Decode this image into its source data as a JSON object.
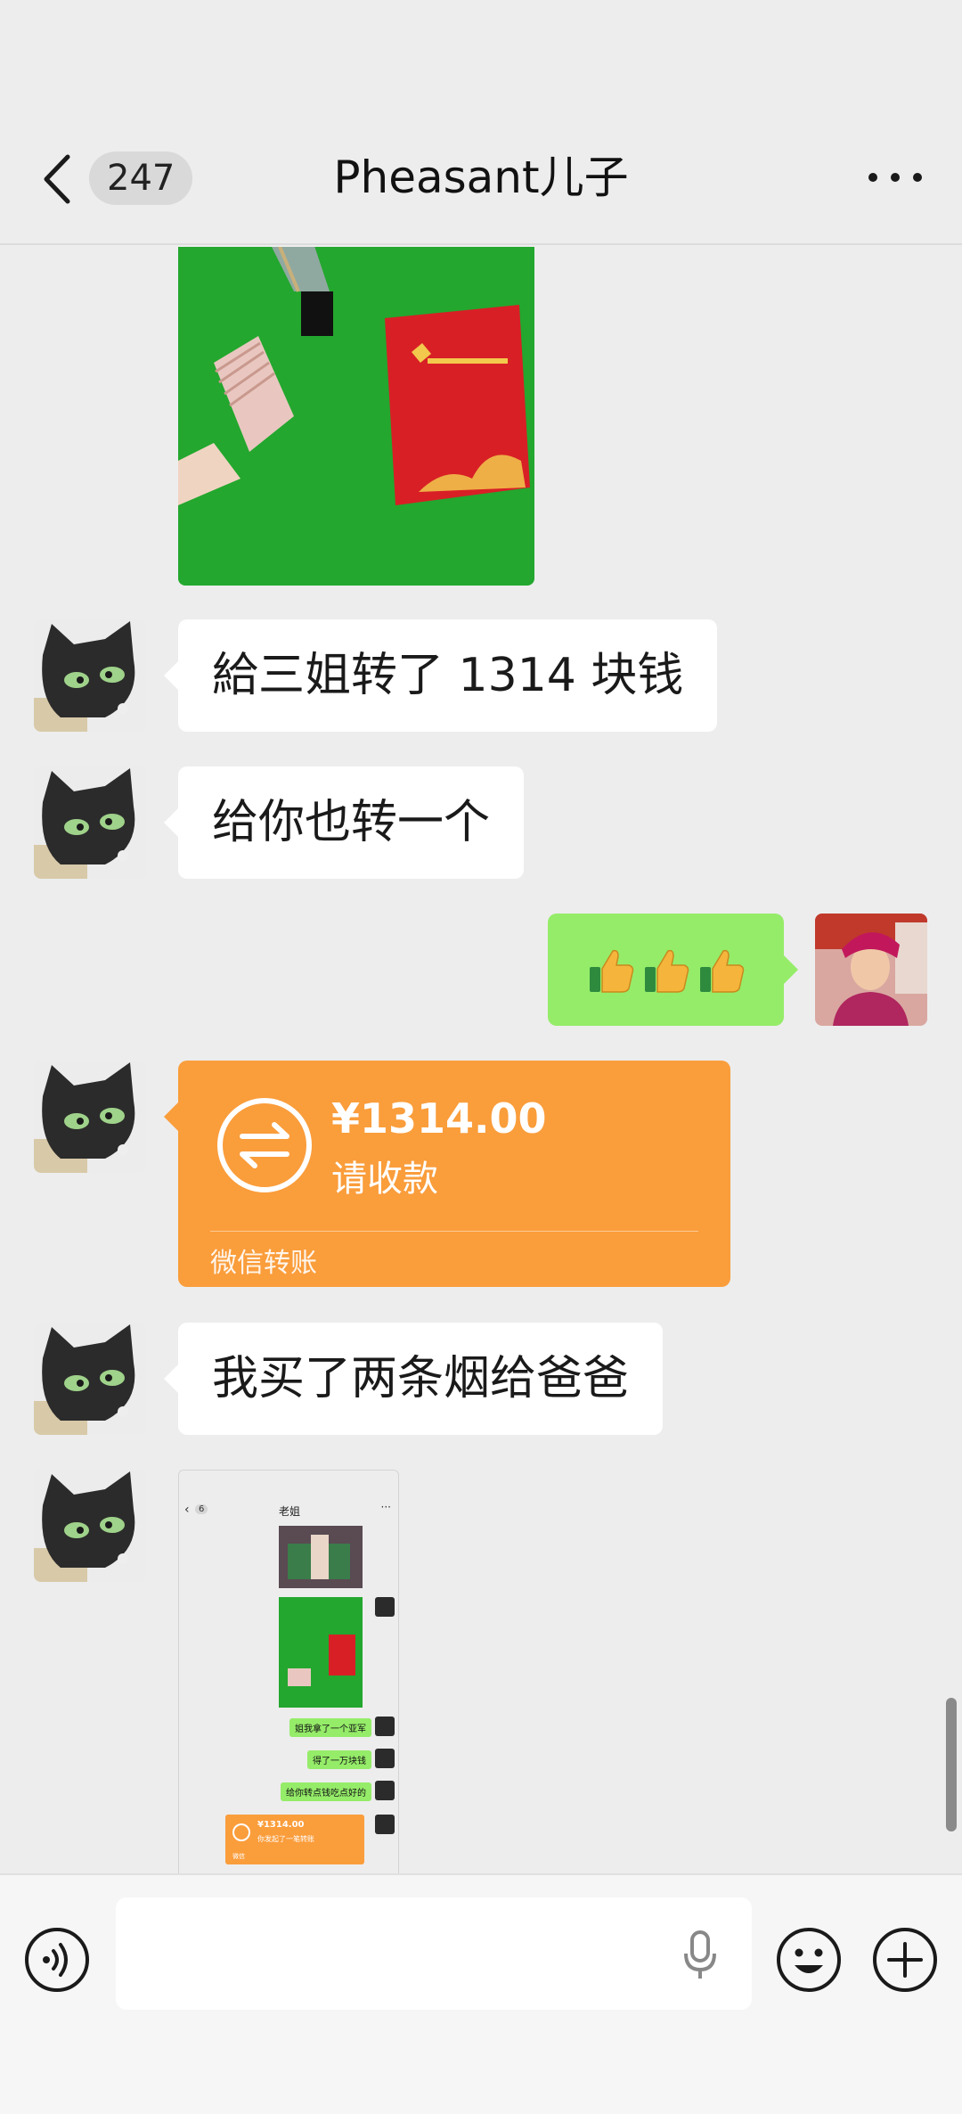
{
  "header": {
    "unread_count": "247",
    "title": "Pheasant儿子"
  },
  "messages": [
    {
      "type": "image",
      "side": "left",
      "description_icon": "photo-thumbnail"
    },
    {
      "type": "text",
      "side": "left",
      "text": "給三姐转了 1314 块钱"
    },
    {
      "type": "text",
      "side": "left",
      "text": "给你也转一个"
    },
    {
      "type": "emoji",
      "side": "right",
      "emoji": "thumbs-up-icon",
      "count": 3
    },
    {
      "type": "transfer",
      "side": "left",
      "amount": "¥1314.00",
      "status": "请收款",
      "source": "微信转账"
    },
    {
      "type": "text",
      "side": "left",
      "text": "我买了两条烟给爸爸"
    },
    {
      "type": "image",
      "side": "left",
      "description_icon": "screenshot-thumbnail"
    }
  ],
  "screenshot_thumb": {
    "back_count": "6",
    "title": "老姐",
    "bubbles": [
      "姐我拿了一个亚军",
      "得了一万块钱",
      "给你转点钱吃点好的"
    ],
    "transfer_amount": "¥1314.00",
    "transfer_status": "你发起了一笔转账",
    "transfer_source": "微信"
  },
  "input": {
    "placeholder": ""
  },
  "colors": {
    "background": "#ededed",
    "green_bubble": "#95ec69",
    "transfer_orange": "#fa9d3b"
  }
}
